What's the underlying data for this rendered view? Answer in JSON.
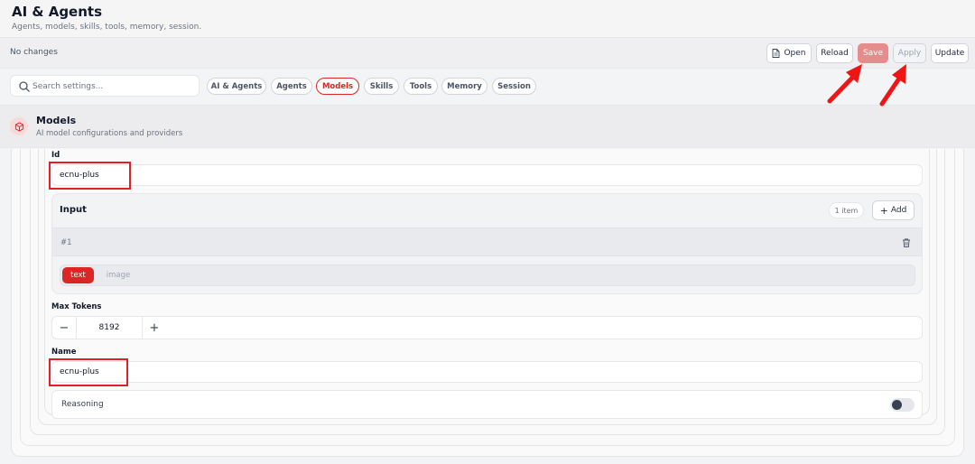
{
  "header": {
    "title": "AI & Agents",
    "subtitle": "Agents, models, skills, tools, memory, session."
  },
  "toolbar": {
    "status": "No changes",
    "open_label": "Open",
    "reload_label": "Reload",
    "save_label": "Save",
    "apply_label": "Apply",
    "update_label": "Update"
  },
  "search": {
    "placeholder": "Search settings..."
  },
  "tabs": [
    {
      "label": "AI & Agents",
      "active": false
    },
    {
      "label": "Agents",
      "active": false
    },
    {
      "label": "Models",
      "active": true
    },
    {
      "label": "Skills",
      "active": false
    },
    {
      "label": "Tools",
      "active": false
    },
    {
      "label": "Memory",
      "active": false
    },
    {
      "label": "Session",
      "active": false
    }
  ],
  "section": {
    "title": "Models",
    "description": "AI model configurations and providers",
    "icon": "cube-icon",
    "accent": "#dc2626"
  },
  "form": {
    "id": {
      "label": "Id",
      "value": "ecnu-plus"
    },
    "input": {
      "title": "Input",
      "count": "1 item",
      "add_label": "Add",
      "items": [
        {
          "number": "#1",
          "options": [
            "text",
            "image"
          ],
          "selected": "text"
        }
      ]
    },
    "max_tokens": {
      "label": "Max Tokens",
      "value": "8192",
      "decrement": "−",
      "increment": "+"
    },
    "name": {
      "label": "Name",
      "value": "ecnu-plus"
    },
    "reasoning": {
      "label": "Reasoning",
      "enabled": false
    }
  },
  "annotations": {
    "highlight_color": "#e0202a",
    "arrow_color": "#f01515"
  }
}
